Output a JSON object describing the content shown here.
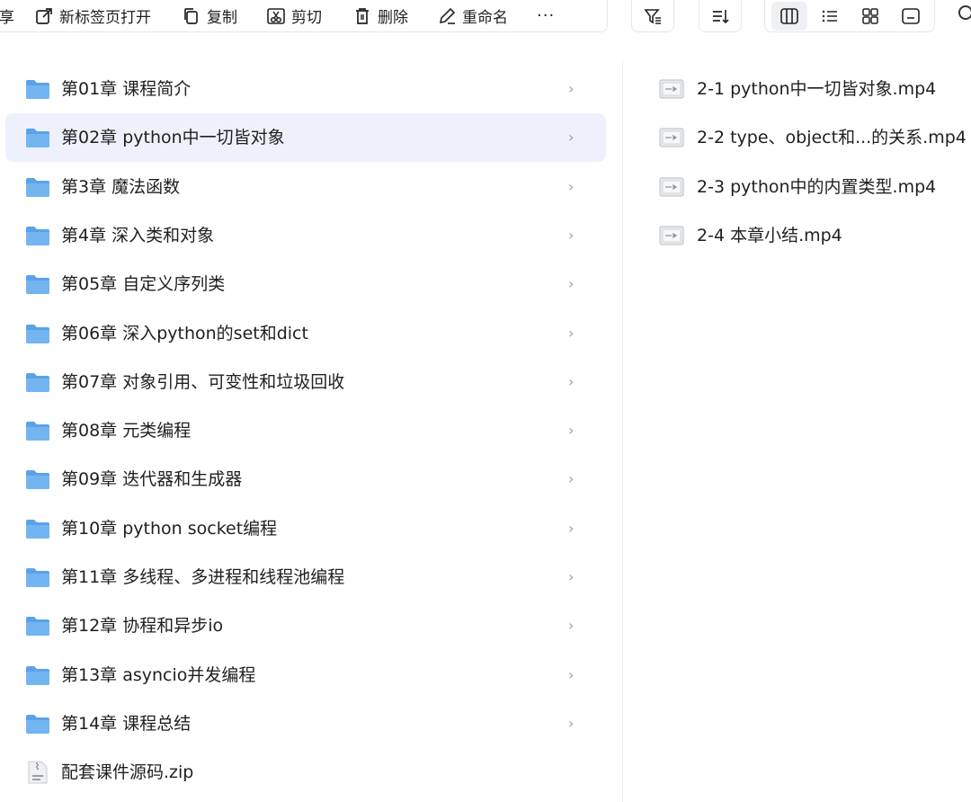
{
  "toolbar": {
    "partial_label": "享",
    "actions": [
      {
        "label": "新标签页打开",
        "icon": "open-new-tab-icon"
      },
      {
        "label": "复制",
        "icon": "copy-icon"
      },
      {
        "label": "剪切",
        "icon": "cut-icon"
      },
      {
        "label": "删除",
        "icon": "trash-icon"
      },
      {
        "label": "重命名",
        "icon": "rename-icon"
      }
    ],
    "more_label": "···",
    "views": [
      "column-view-icon",
      "list-view-icon",
      "grid-view-icon",
      "preview-view-icon"
    ],
    "active_view": "column-view-icon"
  },
  "folders": [
    {
      "label": "第01章 课程简介"
    },
    {
      "label": "第02章 python中一切皆对象",
      "selected": true
    },
    {
      "label": "第3章 魔法函数"
    },
    {
      "label": "第4章 深入类和对象"
    },
    {
      "label": "第05章 自定义序列类"
    },
    {
      "label": "第06章 深入python的set和dict"
    },
    {
      "label": "第07章 对象引用、可变性和垃圾回收"
    },
    {
      "label": "第08章 元类编程"
    },
    {
      "label": "第09章 迭代器和生成器"
    },
    {
      "label": "第10章 python socket编程"
    },
    {
      "label": "第11章 多线程、多进程和线程池编程"
    },
    {
      "label": "第12章 协程和异步io"
    },
    {
      "label": "第13章 asyncio并发编程"
    },
    {
      "label": "第14章 课程总结"
    }
  ],
  "zip_file": {
    "label": "配套课件源码.zip"
  },
  "chevron": "›",
  "files": [
    {
      "label": "2-1 python中一切皆对象.mp4"
    },
    {
      "label": "2-2 type、object和...的关系.mp4"
    },
    {
      "label": "2-3 python中的内置类型.mp4"
    },
    {
      "label": "2-4 本章小结.mp4"
    }
  ],
  "colors": {
    "folder": "#5aa2e8",
    "selected_bg": "#eef1fc",
    "chevron": "#9a9da3"
  }
}
